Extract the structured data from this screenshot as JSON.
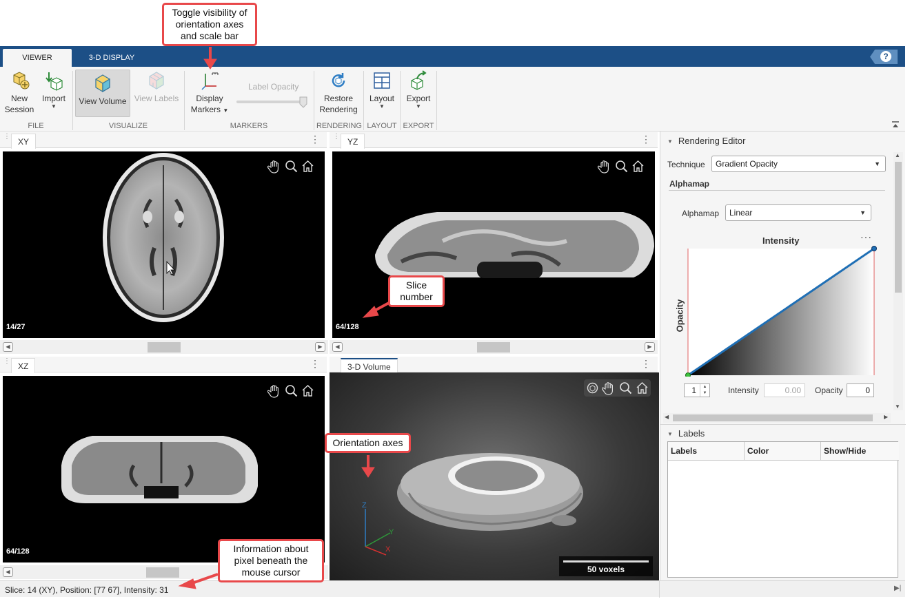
{
  "tabs": [
    {
      "label": "VIEWER",
      "active": true
    },
    {
      "label": "3-D DISPLAY",
      "active": false
    }
  ],
  "help_label": "?",
  "toolstrip": {
    "new_session": {
      "line1": "New",
      "line2": "Session"
    },
    "import": {
      "label": "Import"
    },
    "view_volume": {
      "label": "View Volume"
    },
    "view_labels": {
      "label": "View Labels"
    },
    "display_markers": {
      "line1": "Display",
      "line2": "Markers"
    },
    "label_opacity": {
      "label": "Label Opacity"
    },
    "restore_rendering": {
      "line1": "Restore",
      "line2": "Rendering"
    },
    "layout": {
      "label": "Layout"
    },
    "export": {
      "label": "Export"
    },
    "groups": [
      "FILE",
      "VISUALIZE",
      "MARKERS",
      "RENDERING",
      "LAYOUT",
      "EXPORT"
    ]
  },
  "panes": {
    "xy": {
      "tab": "XY",
      "slice": "14/27"
    },
    "yz": {
      "tab": "YZ",
      "slice": "64/128"
    },
    "xz": {
      "tab": "XZ",
      "slice": "64/128"
    },
    "volume": {
      "tab": "3-D Volume",
      "scale_bar": "50 voxels",
      "axes": {
        "z": "Z",
        "y": "Y",
        "x": "X"
      }
    }
  },
  "rendering_editor": {
    "title": "Rendering Editor",
    "technique_label": "Technique",
    "technique_value": "Gradient Opacity",
    "alphamap_section": "Alphamap",
    "alphamap_label": "Alphamap",
    "alphamap_value": "Linear",
    "plot": {
      "title": "Intensity",
      "ylabel": "Opacity",
      "more": "···"
    },
    "spinner_value": "1",
    "intensity_label": "Intensity",
    "intensity_value": "0.00",
    "opacity_label": "Opacity",
    "opacity_value": "0"
  },
  "labels_panel": {
    "title": "Labels",
    "columns": [
      "Labels",
      "Color",
      "Show/Hide"
    ]
  },
  "status": "Slice: 14 (XY), Position: [77 67], Intensity: 31",
  "callouts": {
    "markers": [
      "Toggle visibility of",
      "orientation axes",
      "and scale bar"
    ],
    "slice": [
      "Slice",
      "number"
    ],
    "axes": [
      "Orientation axes"
    ],
    "pixel": [
      "Information about",
      "pixel beneath the",
      "mouse cursor"
    ]
  },
  "colors": {
    "accent": "#1c4f86",
    "callout": "#e8484a",
    "alphamap_line": "#1f6fb5"
  }
}
